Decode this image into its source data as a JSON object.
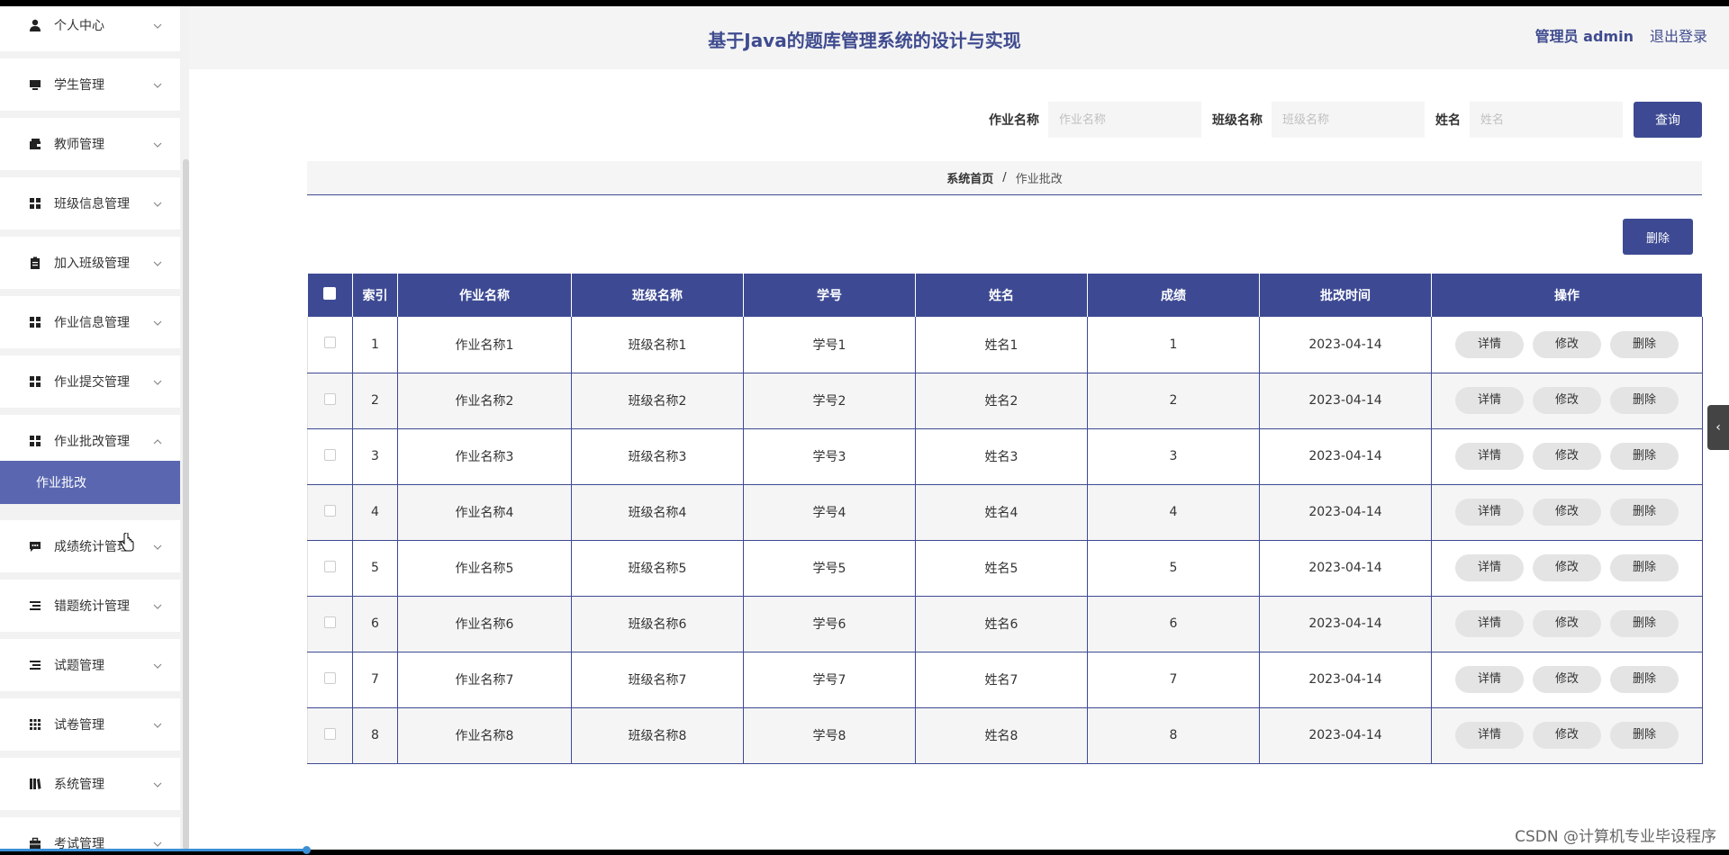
{
  "header": {
    "title": "基于Java的题库管理系统的设计与实现",
    "user": "管理员 admin",
    "logout": "退出登录"
  },
  "sidebar": {
    "items": [
      {
        "label": "个人中心",
        "icon": "user-icon",
        "chevron": "down"
      },
      {
        "label": "学生管理",
        "icon": "monitor-icon",
        "chevron": "down"
      },
      {
        "label": "教师管理",
        "icon": "wallet-icon",
        "chevron": "down"
      },
      {
        "label": "班级信息管理",
        "icon": "grid-icon",
        "chevron": "down"
      },
      {
        "label": "加入班级管理",
        "icon": "clipboard-icon",
        "chevron": "down"
      },
      {
        "label": "作业信息管理",
        "icon": "grid-icon",
        "chevron": "down"
      },
      {
        "label": "作业提交管理",
        "icon": "grid-icon",
        "chevron": "down"
      },
      {
        "label": "作业批改管理",
        "icon": "grid-icon",
        "chevron": "up"
      },
      {
        "label": "成绩统计管理",
        "icon": "chat-icon",
        "chevron": "down"
      },
      {
        "label": "错题统计管理",
        "icon": "list-icon",
        "chevron": "down"
      },
      {
        "label": "试题管理",
        "icon": "list-icon",
        "chevron": "down"
      },
      {
        "label": "试卷管理",
        "icon": "apps-icon",
        "chevron": "down"
      },
      {
        "label": "系统管理",
        "icon": "book-icon",
        "chevron": "down"
      },
      {
        "label": "考试管理",
        "icon": "briefcase-icon",
        "chevron": "down"
      }
    ],
    "active_sub": "作业批改"
  },
  "search": {
    "homework_label": "作业名称",
    "homework_placeholder": "作业名称",
    "class_label": "班级名称",
    "class_placeholder": "班级名称",
    "name_label": "姓名",
    "name_placeholder": "姓名",
    "query_button": "查询"
  },
  "breadcrumb": {
    "home": "系统首页",
    "separator": "/",
    "current": "作业批改"
  },
  "bulk_delete": "删除",
  "table": {
    "columns": [
      "索引",
      "作业名称",
      "班级名称",
      "学号",
      "姓名",
      "成绩",
      "批改时间",
      "操作"
    ],
    "rows": [
      [
        "1",
        "作业名称1",
        "班级名称1",
        "学号1",
        "姓名1",
        "1",
        "2023-04-14"
      ],
      [
        "2",
        "作业名称2",
        "班级名称2",
        "学号2",
        "姓名2",
        "2",
        "2023-04-14"
      ],
      [
        "3",
        "作业名称3",
        "班级名称3",
        "学号3",
        "姓名3",
        "3",
        "2023-04-14"
      ],
      [
        "4",
        "作业名称4",
        "班级名称4",
        "学号4",
        "姓名4",
        "4",
        "2023-04-14"
      ],
      [
        "5",
        "作业名称5",
        "班级名称5",
        "学号5",
        "姓名5",
        "5",
        "2023-04-14"
      ],
      [
        "6",
        "作业名称6",
        "班级名称6",
        "学号6",
        "姓名6",
        "6",
        "2023-04-14"
      ],
      [
        "7",
        "作业名称7",
        "班级名称7",
        "学号7",
        "姓名7",
        "7",
        "2023-04-14"
      ],
      [
        "8",
        "作业名称8",
        "班级名称8",
        "学号8",
        "姓名8",
        "8",
        "2023-04-14"
      ]
    ],
    "actions": [
      "详情",
      "修改",
      "删除"
    ]
  },
  "watermark": "CSDN @计算机专业毕设程序",
  "colors": {
    "primary": "#3d4a93",
    "active_sub_bg": "#5a67b0",
    "title": "#3f4b8f"
  }
}
